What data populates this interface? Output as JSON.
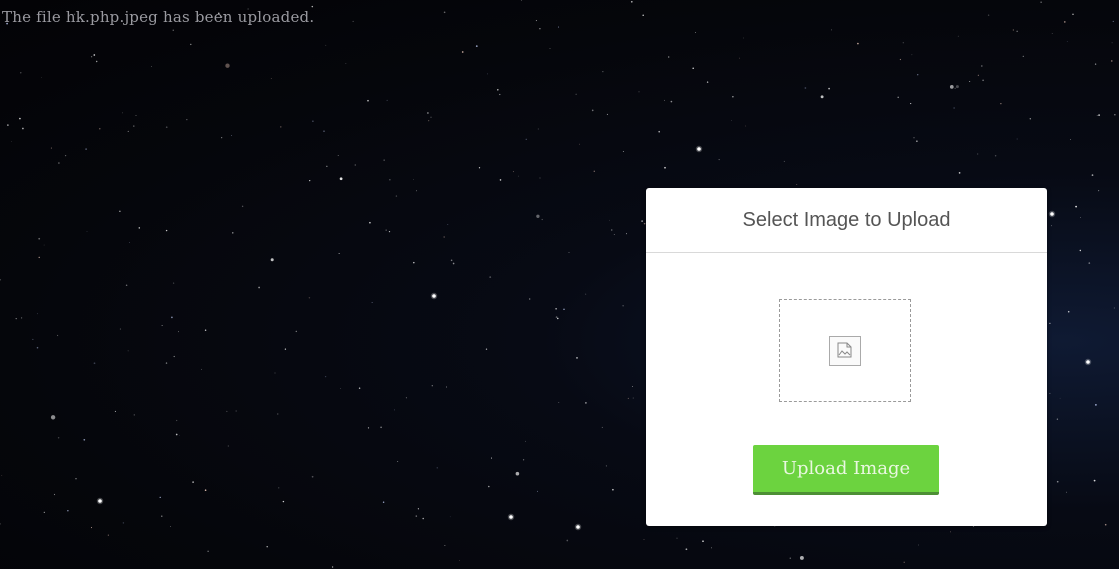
{
  "status": {
    "message": "The file hk.php.jpeg has been uploaded."
  },
  "upload_card": {
    "title": "Select Image to Upload",
    "drop_zone_icon": "image-icon",
    "button_label": "Upload Image"
  },
  "colors": {
    "button_green": "#6cd33f",
    "button_shadow": "#4d8f35",
    "status_text": "#9a9aa0",
    "title_text": "#555555"
  }
}
